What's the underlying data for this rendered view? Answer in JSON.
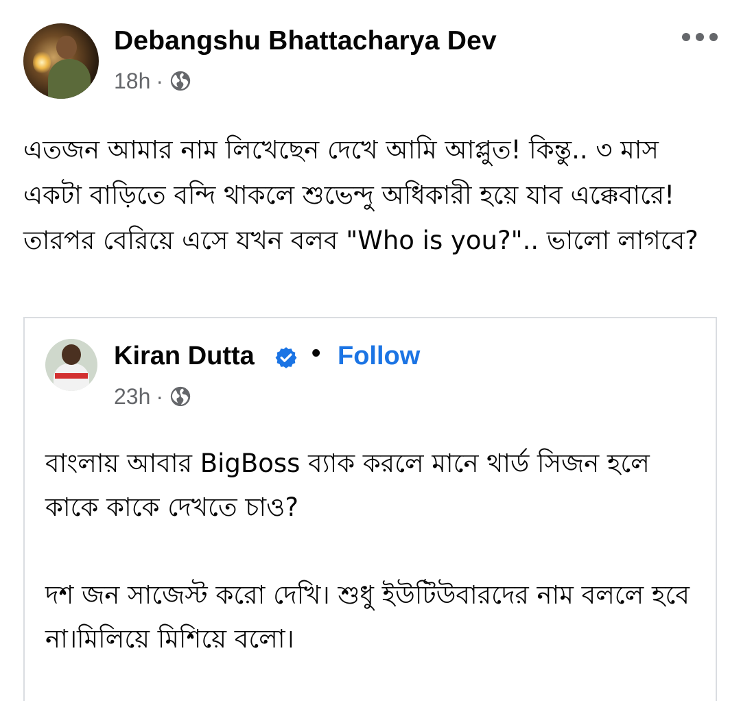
{
  "post": {
    "author": "Debangshu Bhattacharya Dev",
    "time": "18h",
    "separator": "·",
    "privacy_icon": "globe-icon",
    "more_icon": "more-horizontal-icon",
    "text": "এতজন আমার নাম লিখেছেন দেখে আমি আপ্লুত! কিন্তু.. ৩ মাস একটা বাড়িতে বন্দি থাকলে শুভেন্দু অধিকারী হয়ে যাব এক্কেবারে! তারপর বেরিয়ে এসে যখন বলব \"Who is you?\".. ভালো লাগবে?"
  },
  "shared_post": {
    "author": "Kiran Dutta",
    "verified_icon": "verified-badge-icon",
    "dot": "•",
    "follow_label": "Follow",
    "time": "23h",
    "separator": "·",
    "privacy_icon": "globe-icon",
    "paragraph_1": "বাংলায় আবার BigBoss ব্যাক করলে মানে থার্ড সিজন হলে কাকে কাকে দেখতে চাও?",
    "paragraph_2": "দশ জন সাজেস্ট করো দেখি। শুধু ইউটিউবারদের নাম বললে হবে না।মিলিয়ে মিশিয়ে বলো।"
  },
  "colors": {
    "link_blue": "#1b74e4",
    "meta_gray": "#65676b",
    "text_black": "#050505",
    "border": "#dadde1"
  }
}
